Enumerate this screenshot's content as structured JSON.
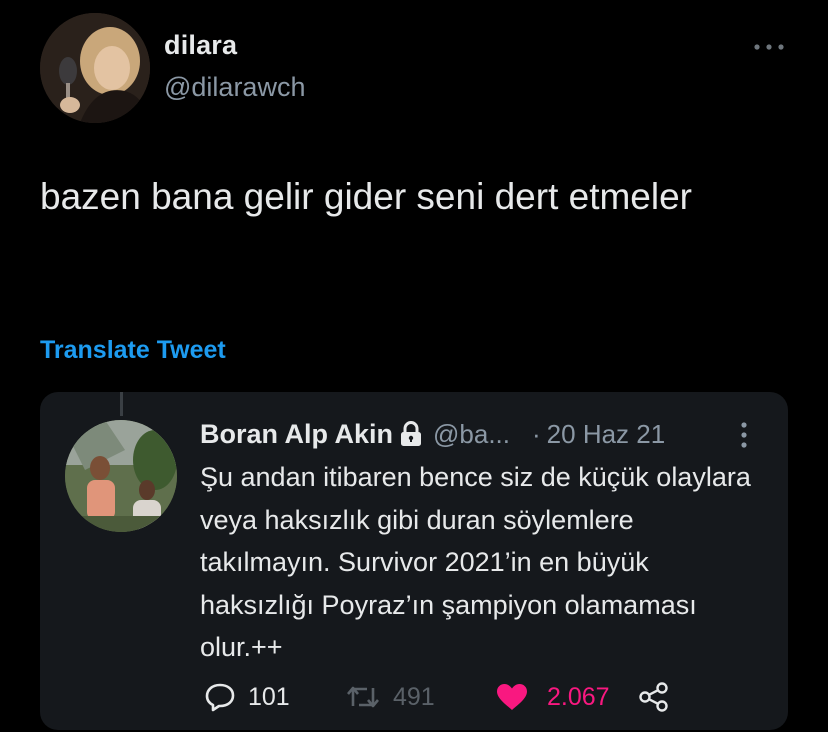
{
  "author": {
    "name": "dilara",
    "handle": "@dilarawch",
    "avatar_icon": "profile-photo"
  },
  "tweet": {
    "text": "bazen bana gelir gider seni dert etmeler",
    "translate_label": "Translate Tweet"
  },
  "quoted_tweet": {
    "name": "Boran Alp Akin",
    "protected_icon": "lock-icon",
    "handle": "@ba...",
    "separator": "·",
    "date": "20 Haz 21",
    "text": "Şu andan itibaren bence siz de küçük olaylara veya haksızlık gibi duran söylemlere takılmayın. Survivor 2021’in en büyük haksızlığı Poyraz’ın şampiyon olamaması olur.++",
    "actions": {
      "replies": "101",
      "retweets": "491",
      "likes": "2.067"
    }
  },
  "colors": {
    "background": "#000000",
    "card": "#15181c",
    "text": "#e7e9ea",
    "muted": "#8b98a5",
    "link": "#1d9bf0",
    "like": "#f91880"
  }
}
